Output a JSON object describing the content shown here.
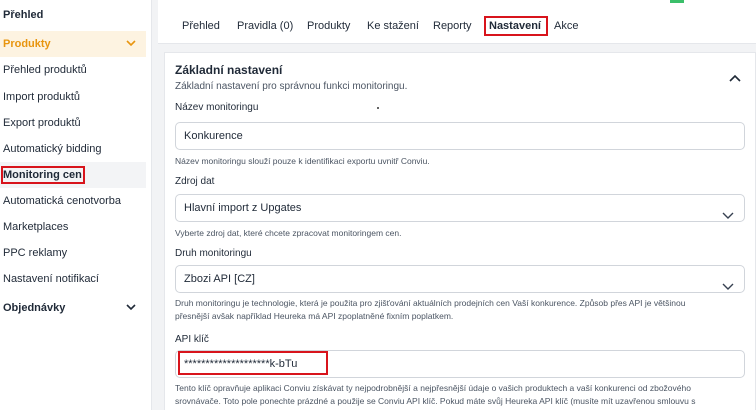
{
  "sidebar": {
    "title": "Přehled",
    "products_section": "Produkty",
    "items": [
      "Přehled produktů",
      "Import produktů",
      "Export produktů",
      "Automatický bidding",
      "Monitoring cen",
      "Automatická cenotvorba",
      "Marketplaces",
      "PPC reklamy",
      "Nastavení notifikací"
    ],
    "orders_section": "Objednávky"
  },
  "tabs": [
    "Přehled",
    "Pravidla (0)",
    "Produkty",
    "Ke stažení",
    "Reporty",
    "Nastavení",
    "Akce"
  ],
  "card": {
    "title": "Základní nastavení",
    "subtitle": "Základní nastavení pro správnou funkci monitoringu.",
    "name_label": "Název monitoringu",
    "name_value": "Konkurence",
    "name_help": "Název monitoringu slouží pouze k identifikaci exportu uvnitř Conviu.",
    "source_label": "Zdroj dat",
    "source_value": "Hlavní import z Upgates",
    "source_help": "Vyberte zdroj dat, které chcete zpracovat monitoringem cen.",
    "type_label": "Druh monitoringu",
    "type_value": "Zbozi API [CZ]",
    "type_help_1": "Druh monitoringu je technologie, která je použita pro zjišťování aktuálních prodejních cen Vaší konkurence. Způsob přes API je většinou",
    "type_help_2": "přesnější avšak například Heureka má API zpoplatněné fixním poplatkem.",
    "api_label": "API klíč",
    "api_value": "********************k-bTu",
    "api_help_1": "Tento klíč opravňuje aplikaci Conviu získávat ty nejpodrobnější a nejpřesnější údaje o vašich produktech a vaší konkurenci od zbožového",
    "api_help_2": "srovnávače. Toto pole ponechte prázdné a použije se Conviu API klíč. Pokud máte svůj Heureka API klíč (musíte mít uzavřenou smlouvu s"
  },
  "colors": {
    "accent": "#e8950f",
    "highlight_box": "#d8141c",
    "status_mark": "#3bbf6a"
  }
}
